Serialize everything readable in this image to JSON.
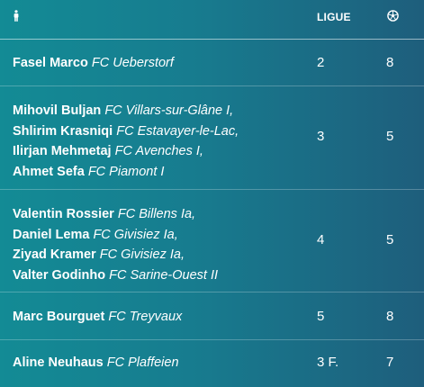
{
  "header": {
    "person_icon": "person-icon",
    "ligue_label": "LIGUE",
    "goals_icon": "soccer-ball-icon"
  },
  "rows": [
    {
      "players": [
        {
          "name": "Fasel Marco",
          "club": "FC Ueberstorf"
        }
      ],
      "ligue": "2",
      "goals": "8"
    },
    {
      "players": [
        {
          "name": "Mihovil Buljan",
          "club": "FC Villars-sur-Glâne I,"
        },
        {
          "name": "Shlirim Krasniqi",
          "club": "FC Estavayer-le-Lac,"
        },
        {
          "name": "Ilirjan Mehmetaj",
          "club": "FC Avenches I,"
        },
        {
          "name": "Ahmet Sefa",
          "club": "FC Piamont I"
        }
      ],
      "ligue": "3",
      "goals": "5"
    },
    {
      "players": [
        {
          "name": "Valentin Rossier",
          "club": "FC Billens Ia,"
        },
        {
          "name": "Daniel Lema",
          "club": "FC Givisiez Ia,"
        },
        {
          "name": "Ziyad Kramer",
          "club": "FC Givisiez Ia,"
        },
        {
          "name": "Valter Godinho",
          "club": "FC Sarine-Ouest II"
        }
      ],
      "ligue": "4",
      "goals": "5"
    },
    {
      "players": [
        {
          "name": "Marc Bourguet",
          "club": "FC Treyvaux"
        }
      ],
      "ligue": "5",
      "goals": "8"
    },
    {
      "players": [
        {
          "name": "Aline Neuhaus",
          "club": "FC Plaffeien"
        }
      ],
      "ligue": "3 F.",
      "goals": "7"
    }
  ]
}
